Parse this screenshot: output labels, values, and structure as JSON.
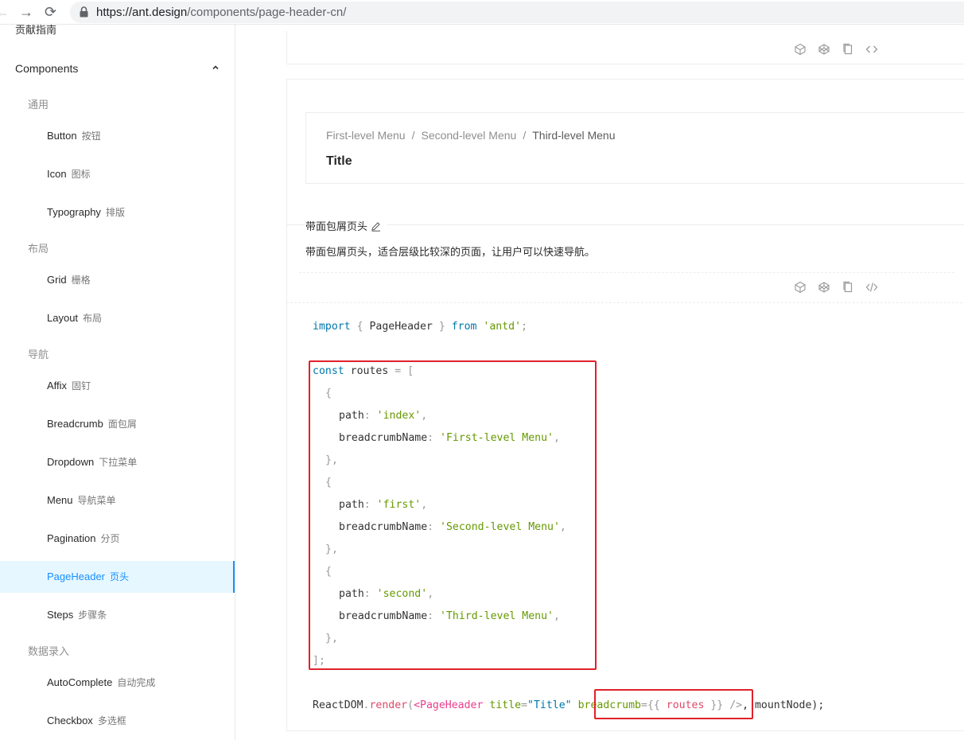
{
  "browser": {
    "back_icon": "arrow-left-icon",
    "forward_icon": "arrow-right-icon",
    "reload_icon": "reload-icon",
    "url_host": "https://ant.design",
    "url_path": "/components/page-header-cn/"
  },
  "sidebar": {
    "cut_item": "贡献指南",
    "section_title": "Components",
    "groups": {
      "general": "通用",
      "layout": "布局",
      "navigation": "导航",
      "data_entry": "数据录入"
    },
    "items": [
      {
        "label": "Button",
        "cn": "按钮"
      },
      {
        "label": "Icon",
        "cn": "图标"
      },
      {
        "label": "Typography",
        "cn": "排版"
      },
      {
        "label": "Grid",
        "cn": "栅格"
      },
      {
        "label": "Layout",
        "cn": "布局"
      },
      {
        "label": "Affix",
        "cn": "固钉"
      },
      {
        "label": "Breadcrumb",
        "cn": "面包屑"
      },
      {
        "label": "Dropdown",
        "cn": "下拉菜单"
      },
      {
        "label": "Menu",
        "cn": "导航菜单"
      },
      {
        "label": "Pagination",
        "cn": "分页"
      },
      {
        "label": "PageHeader",
        "cn": "页头",
        "active": true
      },
      {
        "label": "Steps",
        "cn": "步骤条"
      },
      {
        "label": "AutoComplete",
        "cn": "自动完成"
      },
      {
        "label": "Checkbox",
        "cn": "多选框"
      }
    ]
  },
  "demo": {
    "breadcrumb": [
      "First-level Menu",
      "Second-level Menu",
      "Third-level Menu"
    ],
    "separator": "/",
    "title": "Title",
    "meta_title": "带面包屑页头",
    "meta_desc": "带面包屑页头，适合层级比较深的页面，让用户可以快速导航。",
    "action_icons": [
      "codesandbox-icon",
      "codepen-icon",
      "copy-icon",
      "expand-code-icon"
    ]
  },
  "code": {
    "import": {
      "kw1": "import",
      "p1": " { ",
      "name": "PageHeader",
      "p2": " } ",
      "kw2": "from",
      "sp": " ",
      "src": "'antd'",
      "end": ";"
    },
    "const_line": {
      "kw": "const",
      "name": " routes ",
      "eq": "= ",
      "br": "["
    },
    "open_brace": "{",
    "close_brace": "},",
    "path_key": "path",
    "colon": ": ",
    "comma": ",",
    "name_key": "breadcrumbName",
    "routes": [
      {
        "path": "'index'",
        "name": "'First-level Menu'"
      },
      {
        "path": "'first'",
        "name": "'Second-level Menu'"
      },
      {
        "path": "'second'",
        "name": "'Third-level Menu'"
      }
    ],
    "close_array": "];",
    "render": {
      "obj": "ReactDOM",
      "dot": ".",
      "fn": "render",
      "paren": "(",
      "lt": "<",
      "tag": "PageHeader",
      "sp": " ",
      "attr1": "title",
      "eq1": "=",
      "val1": "\"Title\"",
      "sp2": " ",
      "attr2": "breadcrumb",
      "eq2": "=",
      "brace_open": "{{",
      "val2": " routes ",
      "brace_close": "}}",
      "end": " />",
      "tail": ", mountNode);"
    }
  }
}
